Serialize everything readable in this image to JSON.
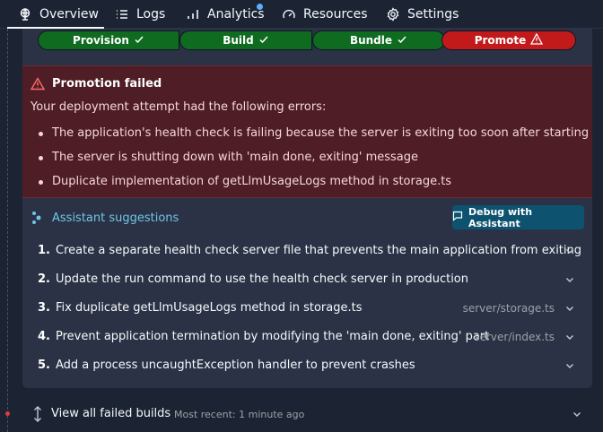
{
  "nav": {
    "tabs": [
      {
        "label": "Overview",
        "icon": "globe-icon",
        "active": true
      },
      {
        "label": "Logs",
        "icon": "list-icon"
      },
      {
        "label": "Analytics",
        "icon": "bar-chart-icon",
        "has_notification": true
      },
      {
        "label": "Resources",
        "icon": "gauge-icon"
      },
      {
        "label": "Settings",
        "icon": "gear-icon"
      }
    ]
  },
  "pipeline": {
    "steps": [
      {
        "label": "Provision",
        "status": "success"
      },
      {
        "label": "Build",
        "status": "success"
      },
      {
        "label": "Bundle",
        "status": "success"
      },
      {
        "label": "Promote",
        "status": "failed"
      }
    ]
  },
  "error": {
    "title": "Promotion failed",
    "subtitle": "Your deployment attempt had the following errors:",
    "items": [
      "The application's health check is failing because the server is exiting too soon after starting up",
      "The server is shutting down with 'main done, exiting' message",
      "Duplicate implementation of getLlmUsageLogs method in storage.ts"
    ]
  },
  "assistant": {
    "title": "Assistant suggestions",
    "debug_button": "Debug with Assistant",
    "suggestions": [
      {
        "num": "1.",
        "text": "Create a separate health check server file that prevents the main application from exiting",
        "file": ""
      },
      {
        "num": "2.",
        "text": "Update the run command to use the health check server in production",
        "file": ""
      },
      {
        "num": "3.",
        "text": "Fix duplicate getLlmUsageLogs method in storage.ts",
        "file": "server/storage.ts"
      },
      {
        "num": "4.",
        "text": "Prevent application termination by modifying the 'main done, exiting' part",
        "file": "server/index.ts"
      },
      {
        "num": "5.",
        "text": "Add a process uncaughtException handler to prevent crashes",
        "file": ""
      }
    ]
  },
  "footer": {
    "label": "View all failed builds",
    "meta": "Most recent: 1 minute ago"
  },
  "colors": {
    "background": "#1c2333",
    "card": "#2b3245",
    "success": "#0e6b1f",
    "failed": "#c21a1a",
    "error_bg": "#4e1d25",
    "accent": "#6fc6e8"
  }
}
